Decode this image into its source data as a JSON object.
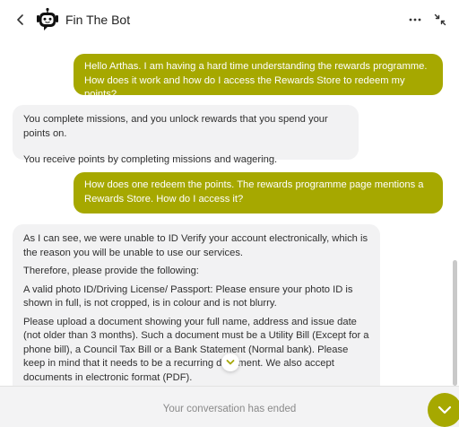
{
  "header": {
    "title": "Fin The Bot",
    "back_icon": "chevron-left-icon",
    "avatar_icon": "robot-icon",
    "more_icon": "more-horizontal-icon",
    "collapse_icon": "collapse-arrows-icon"
  },
  "messages": [
    {
      "role": "user",
      "paragraphs": [
        "Hello Arthas. I am having a hard time understanding the rewards programme. How does it work and how do I access the Rewards Store to redeem my points?"
      ]
    },
    {
      "role": "bot",
      "paragraphs": [
        "You complete missions, and you unlock rewards that you spend your points on.",
        "You receive points by completing missions and wagering."
      ]
    },
    {
      "role": "user",
      "paragraphs": [
        "How does one redeem the points. The rewards programme page mentions a Rewards Store. How do I access it?"
      ]
    },
    {
      "role": "bot",
      "paragraphs": [
        "As I can see, we were unable to ID Verify your account electronically, which is the reason you will be unable to use our services.",
        "Therefore, please provide the following:",
        "A valid photo ID/Driving License/ Passport: Please ensure your photo ID is shown in full, is not cropped, is in colour and is not blurry.",
        "Please upload a document showing your full name, address and issue date (not older than 3 months). Such a document must be a Utility Bill (Except for a phone bill), a Council Tax Bill or a Bank Statement (Normal bank). Please keep in mind that it needs to be a recurring document. We also accept documents in electronic format (PDF)."
      ]
    }
  ],
  "footer": {
    "status": "Your conversation has ended"
  },
  "colors": {
    "accent": "#a6a800",
    "bot_bubble": "#f2f2f3",
    "footer_bg": "#f3f3f4"
  }
}
